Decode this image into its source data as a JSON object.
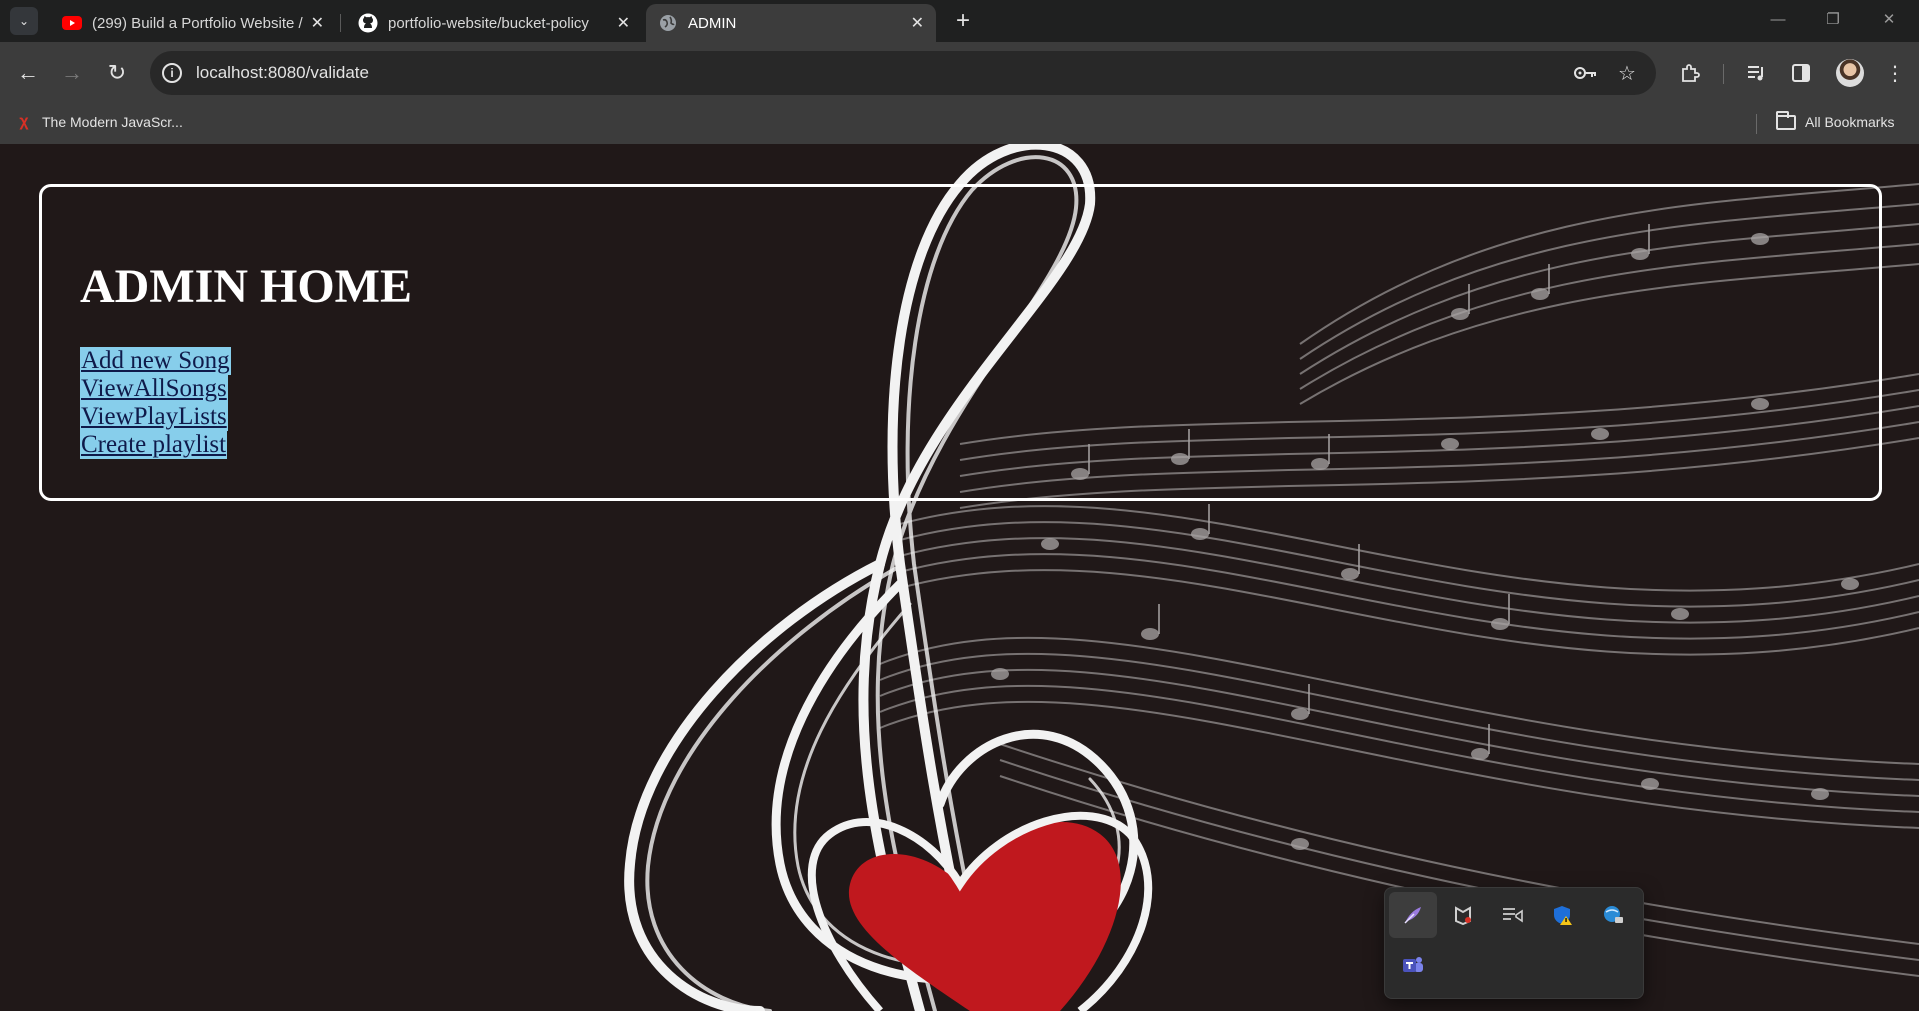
{
  "browser": {
    "tabs": [
      {
        "title": "(299) Build a Portfolio Website /",
        "favicon": "youtube-icon"
      },
      {
        "title": "portfolio-website/bucket-policy",
        "favicon": "github-icon"
      },
      {
        "title": "ADMIN",
        "favicon": "globe-icon",
        "active": true
      }
    ],
    "url": "localhost:8080/validate",
    "bookmark": {
      "label": "The Modern JavaScr...",
      "favicon": "bookmark-favicon-icon"
    },
    "all_bookmarks_label": "All Bookmarks"
  },
  "page": {
    "title": "ADMIN HOME",
    "links": [
      "Add new Song",
      "ViewAllSongs",
      "ViewPlayLists",
      "Create playlist"
    ],
    "link_highlight_color": "#87ceeb",
    "background_color": "#201818",
    "heart_color": "#c0181e"
  },
  "tray": {
    "icons": [
      "feather-icon",
      "mcafee-icon",
      "media-cast-icon",
      "defender-warning-icon",
      "network-drive-icon",
      "teams-icon"
    ]
  }
}
